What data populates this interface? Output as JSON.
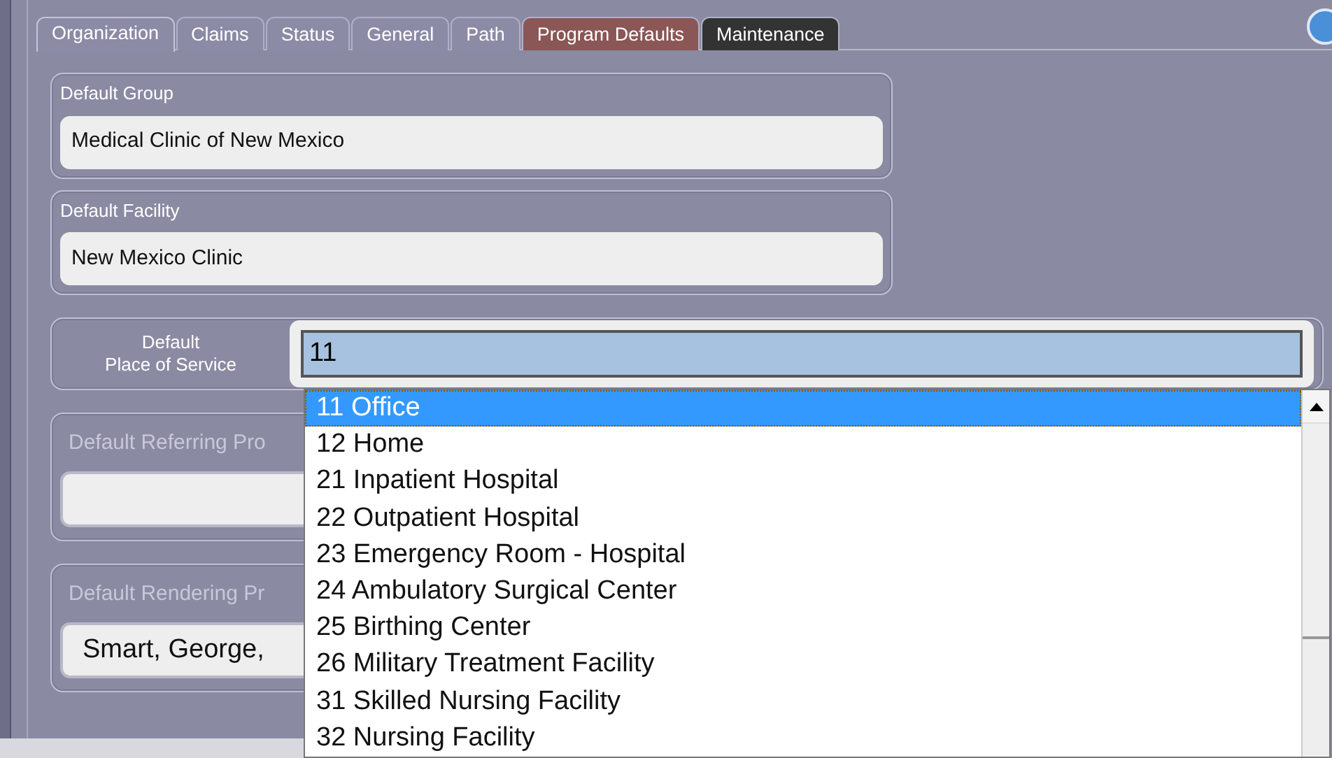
{
  "tabs": [
    {
      "label": "Organization",
      "selected": true,
      "color": "#8b8ba6"
    },
    {
      "label": "Claims",
      "selected": false,
      "color": "#8b8ba6"
    },
    {
      "label": "Status",
      "selected": false,
      "color": "#8b8ba6"
    },
    {
      "label": "General",
      "selected": false,
      "color": "#8b8ba6"
    },
    {
      "label": "Path",
      "selected": false,
      "color": "#8b8ba6"
    },
    {
      "label": "Program Defaults",
      "selected": false,
      "color": "#8a5656"
    },
    {
      "label": "Maintenance",
      "selected": false,
      "color": "#333333"
    }
  ],
  "default_group": {
    "label": "Default Group",
    "value": "Medical Clinic of New Mexico"
  },
  "default_facility": {
    "label": "Default Facility",
    "value": "New Mexico Clinic"
  },
  "place_of_service": {
    "label_lines": [
      "Default",
      "Place of Service"
    ],
    "value": "11",
    "options": [
      {
        "label": "11 Office",
        "selected": true
      },
      {
        "label": "12 Home",
        "selected": false
      },
      {
        "label": "21 Inpatient Hospital",
        "selected": false
      },
      {
        "label": "22 Outpatient Hospital",
        "selected": false
      },
      {
        "label": "23 Emergency Room - Hospital",
        "selected": false
      },
      {
        "label": "24 Ambulatory Surgical Center",
        "selected": false
      },
      {
        "label": "25 Birthing Center",
        "selected": false
      },
      {
        "label": "26 Military Treatment Facility",
        "selected": false
      },
      {
        "label": "31 Skilled Nursing Facility",
        "selected": false
      },
      {
        "label": "32 Nursing Facility",
        "selected": false
      }
    ]
  },
  "default_referring": {
    "label": "Default Referring Pro"
  },
  "default_rendering": {
    "label": "Default Rendering Pr",
    "value": "Smart, George,"
  }
}
